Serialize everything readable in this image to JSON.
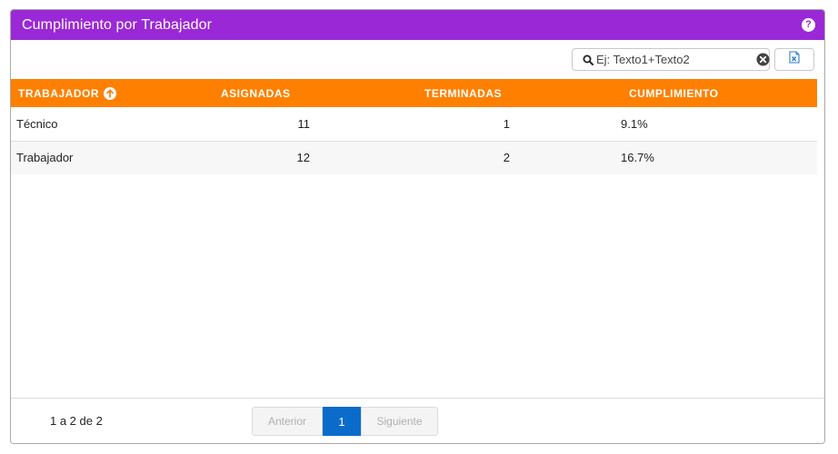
{
  "panel": {
    "title": "Cumplimiento por Trabajador",
    "help_icon": "question-circle-icon"
  },
  "search": {
    "placeholder": "Ej: Texto1+Texto2",
    "value": ""
  },
  "export": {
    "icon": "excel-file-icon"
  },
  "table": {
    "columns": [
      {
        "label": "TRABAJADOR",
        "sorted": "ascending"
      },
      {
        "label": "ASIGNADAS"
      },
      {
        "label": "TERMINADAS"
      },
      {
        "label": "CUMPLIMIENTO"
      }
    ],
    "rows": [
      {
        "trabajador": "Técnico",
        "asignadas": "11",
        "terminadas": "1",
        "cumplimiento": "9.1%"
      },
      {
        "trabajador": "Trabajador",
        "asignadas": "12",
        "terminadas": "2",
        "cumplimiento": "16.7%"
      }
    ]
  },
  "pagination": {
    "info": "1 a 2 de 2",
    "prev_label": "Anterior",
    "current_page": "1",
    "next_label": "Siguiente"
  },
  "colors": {
    "header": "#9b28d6",
    "table_header": "#ff8000",
    "current_page": "#0b6bcb"
  }
}
